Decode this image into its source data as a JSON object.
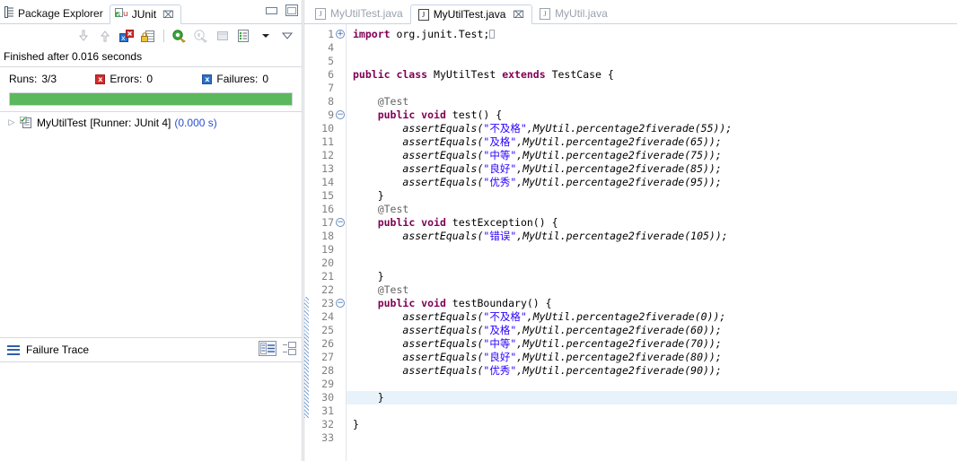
{
  "left_panel": {
    "tabs": [
      {
        "label": "Package Explorer",
        "icon": "package-explorer-icon",
        "active": false,
        "closable": false
      },
      {
        "label": "JUnit",
        "icon": "junit-icon",
        "active": true,
        "closable": true,
        "close_glyph": "⌧"
      }
    ],
    "window_buttons": [
      {
        "name": "minimize-button",
        "title": "Minimize"
      },
      {
        "name": "maximize-button",
        "title": "Maximize"
      }
    ],
    "toolbar": [
      {
        "name": "next-failure-button",
        "glyph": "⇩",
        "state": "disabled"
      },
      {
        "name": "previous-failure-button",
        "glyph": "⇧",
        "state": "disabled"
      },
      {
        "name": "show-failures-only-button",
        "glyph": "x",
        "state": "enabled"
      },
      {
        "name": "scroll-lock-button",
        "glyph": "ὑ2",
        "state": "enabled"
      },
      {
        "name": "separator",
        "glyph": "",
        "state": "none"
      },
      {
        "name": "rerun-test-button",
        "glyph": "",
        "state": "enabled"
      },
      {
        "name": "rerun-failed-tests-button",
        "glyph": "",
        "state": "disabled"
      },
      {
        "name": "stop-button",
        "glyph": "",
        "state": "disabled"
      },
      {
        "name": "test-history-button",
        "glyph": "",
        "state": "enabled"
      },
      {
        "name": "history-dropdown-button",
        "glyph": "▾",
        "state": "enabled"
      },
      {
        "name": "view-menu-button",
        "glyph": "▽",
        "state": "enabled"
      }
    ],
    "status": "Finished after 0.016 seconds",
    "counters": {
      "runs_label": "Runs:",
      "runs_value": "3/3",
      "errors_label": "Errors:",
      "errors_value": "0",
      "failures_label": "Failures:",
      "failures_value": "0"
    },
    "progress": {
      "percent": 100,
      "color": "#5cb85c",
      "state": "passed"
    },
    "tree": [
      {
        "twisty": "▷",
        "icon": "test-class-icon",
        "name": "MyUtilTest",
        "runner": "[Runner: JUnit 4]",
        "time": "(0.000 s)"
      }
    ],
    "failure_trace": {
      "title": "Failure Trace",
      "tools": [
        {
          "name": "compare-results-button"
        },
        {
          "name": "trace-layout-button"
        }
      ],
      "content": ""
    }
  },
  "editor": {
    "tabs": [
      {
        "label": "MyUtilTest.java",
        "icon": "java-file-icon",
        "active": false,
        "closable": false
      },
      {
        "label": "MyUtilTest.java",
        "icon": "java-file-icon",
        "active": true,
        "closable": true,
        "close_glyph": "⌧"
      },
      {
        "label": "MyUtil.java",
        "icon": "java-file-icon",
        "active": false,
        "closable": false
      }
    ],
    "gutter_lines": [
      "1",
      "4",
      "5",
      "6",
      "7",
      "8",
      "9",
      "10",
      "11",
      "12",
      "13",
      "14",
      "15",
      "16",
      "17",
      "18",
      "19",
      "20",
      "21",
      "22",
      "23",
      "24",
      "25",
      "26",
      "27",
      "28",
      "29",
      "30",
      "31",
      "32",
      "33"
    ],
    "fold_markers": [
      {
        "line_index": 0,
        "glyph": "⊕",
        "type": "collapsed"
      },
      {
        "line_index": 6,
        "glyph": "⊖",
        "type": "expanded"
      },
      {
        "line_index": 14,
        "glyph": "⊖",
        "type": "expanded"
      },
      {
        "line_index": 20,
        "glyph": "⊖",
        "type": "expanded"
      }
    ],
    "changed_lines": {
      "from_index": 20,
      "to_index": 28
    },
    "highlighted_line_index": 27,
    "code_lines": [
      {
        "indent": 0,
        "parts": [
          {
            "t": "import",
            "c": "kw"
          },
          {
            "t": " org.junit.Test;",
            "c": ""
          },
          {
            "t": "□",
            "c": "caret"
          }
        ]
      },
      {
        "indent": 0,
        "parts": []
      },
      {
        "indent": 0,
        "parts": []
      },
      {
        "indent": 0,
        "parts": [
          {
            "t": "public class",
            "c": "kw"
          },
          {
            "t": " MyUtilTest ",
            "c": ""
          },
          {
            "t": "extends",
            "c": "kw"
          },
          {
            "t": " TestCase {",
            "c": ""
          }
        ]
      },
      {
        "indent": 0,
        "parts": []
      },
      {
        "indent": 1,
        "parts": [
          {
            "t": "@Test",
            "c": "ann"
          }
        ]
      },
      {
        "indent": 1,
        "parts": [
          {
            "t": "public void",
            "c": "kw"
          },
          {
            "t": " test() {",
            "c": ""
          }
        ]
      },
      {
        "indent": 2,
        "parts": [
          {
            "t": "assertEquals(",
            "c": "stat"
          },
          {
            "t": "\"不及格\"",
            "c": "str"
          },
          {
            "t": ",MyUtil.",
            "c": "stat"
          },
          {
            "t": "percentage2fiverade",
            "c": "mth"
          },
          {
            "t": "(55));",
            "c": "stat"
          }
        ]
      },
      {
        "indent": 2,
        "parts": [
          {
            "t": "assertEquals(",
            "c": "stat"
          },
          {
            "t": "\"及格\"",
            "c": "str"
          },
          {
            "t": ",MyUtil.",
            "c": "stat"
          },
          {
            "t": "percentage2fiverade",
            "c": "mth"
          },
          {
            "t": "(65));",
            "c": "stat"
          }
        ]
      },
      {
        "indent": 2,
        "parts": [
          {
            "t": "assertEquals(",
            "c": "stat"
          },
          {
            "t": "\"中等\"",
            "c": "str"
          },
          {
            "t": ",MyUtil.",
            "c": "stat"
          },
          {
            "t": "percentage2fiverade",
            "c": "mth"
          },
          {
            "t": "(75));",
            "c": "stat"
          }
        ]
      },
      {
        "indent": 2,
        "parts": [
          {
            "t": "assertEquals(",
            "c": "stat"
          },
          {
            "t": "\"良好\"",
            "c": "str"
          },
          {
            "t": ",MyUtil.",
            "c": "stat"
          },
          {
            "t": "percentage2fiverade",
            "c": "mth"
          },
          {
            "t": "(85));",
            "c": "stat"
          }
        ]
      },
      {
        "indent": 2,
        "parts": [
          {
            "t": "assertEquals(",
            "c": "stat"
          },
          {
            "t": "\"优秀\"",
            "c": "str"
          },
          {
            "t": ",MyUtil.",
            "c": "stat"
          },
          {
            "t": "percentage2fiverade",
            "c": "mth"
          },
          {
            "t": "(95));",
            "c": "stat"
          }
        ]
      },
      {
        "indent": 1,
        "parts": [
          {
            "t": "}",
            "c": ""
          }
        ]
      },
      {
        "indent": 1,
        "parts": [
          {
            "t": "@Test",
            "c": "ann"
          }
        ]
      },
      {
        "indent": 1,
        "parts": [
          {
            "t": "public void",
            "c": "kw"
          },
          {
            "t": " testException() {",
            "c": ""
          }
        ]
      },
      {
        "indent": 2,
        "parts": [
          {
            "t": "assertEquals(",
            "c": "stat"
          },
          {
            "t": "\"错误\"",
            "c": "str"
          },
          {
            "t": ",MyUtil.",
            "c": "stat"
          },
          {
            "t": "percentage2fiverade",
            "c": "mth"
          },
          {
            "t": "(105));",
            "c": "stat"
          }
        ]
      },
      {
        "indent": 0,
        "parts": []
      },
      {
        "indent": 0,
        "parts": []
      },
      {
        "indent": 1,
        "parts": [
          {
            "t": "}",
            "c": ""
          }
        ]
      },
      {
        "indent": 1,
        "parts": [
          {
            "t": "@Test",
            "c": "ann"
          }
        ]
      },
      {
        "indent": 1,
        "parts": [
          {
            "t": "public void",
            "c": "kw"
          },
          {
            "t": " testBoundary() {",
            "c": ""
          }
        ]
      },
      {
        "indent": 2,
        "parts": [
          {
            "t": "assertEquals(",
            "c": "stat"
          },
          {
            "t": "\"不及格\"",
            "c": "str"
          },
          {
            "t": ",MyUtil.",
            "c": "stat"
          },
          {
            "t": "percentage2fiverade",
            "c": "mth"
          },
          {
            "t": "(0));",
            "c": "stat"
          }
        ]
      },
      {
        "indent": 2,
        "parts": [
          {
            "t": "assertEquals(",
            "c": "stat"
          },
          {
            "t": "\"及格\"",
            "c": "str"
          },
          {
            "t": ",MyUtil.",
            "c": "stat"
          },
          {
            "t": "percentage2fiverade",
            "c": "mth"
          },
          {
            "t": "(60));",
            "c": "stat"
          }
        ]
      },
      {
        "indent": 2,
        "parts": [
          {
            "t": "assertEquals(",
            "c": "stat"
          },
          {
            "t": "\"中等\"",
            "c": "str"
          },
          {
            "t": ",MyUtil.",
            "c": "stat"
          },
          {
            "t": "percentage2fiverade",
            "c": "mth"
          },
          {
            "t": "(70));",
            "c": "stat"
          }
        ]
      },
      {
        "indent": 2,
        "parts": [
          {
            "t": "assertEquals(",
            "c": "stat"
          },
          {
            "t": "\"良好\"",
            "c": "str"
          },
          {
            "t": ",MyUtil.",
            "c": "stat"
          },
          {
            "t": "percentage2fiverade",
            "c": "mth"
          },
          {
            "t": "(80));",
            "c": "stat"
          }
        ]
      },
      {
        "indent": 2,
        "parts": [
          {
            "t": "assertEquals(",
            "c": "stat"
          },
          {
            "t": "\"优秀\"",
            "c": "str"
          },
          {
            "t": ",MyUtil.",
            "c": "stat"
          },
          {
            "t": "percentage2fiverade",
            "c": "mth"
          },
          {
            "t": "(90));",
            "c": "stat"
          }
        ]
      },
      {
        "indent": 0,
        "parts": []
      },
      {
        "indent": 1,
        "parts": [
          {
            "t": "}",
            "c": ""
          }
        ]
      },
      {
        "indent": 0,
        "parts": []
      },
      {
        "indent": 0,
        "parts": [
          {
            "t": "}",
            "c": ""
          }
        ]
      },
      {
        "indent": 0,
        "parts": []
      }
    ]
  },
  "colors": {
    "keyword": "#7f0055",
    "string": "#2a00ff",
    "annotation": "#646464",
    "pass_green": "#5cb85c",
    "error_red": "#d22b2b",
    "failure_blue": "#2a6fc9",
    "time_blue": "#2a4fd0"
  }
}
